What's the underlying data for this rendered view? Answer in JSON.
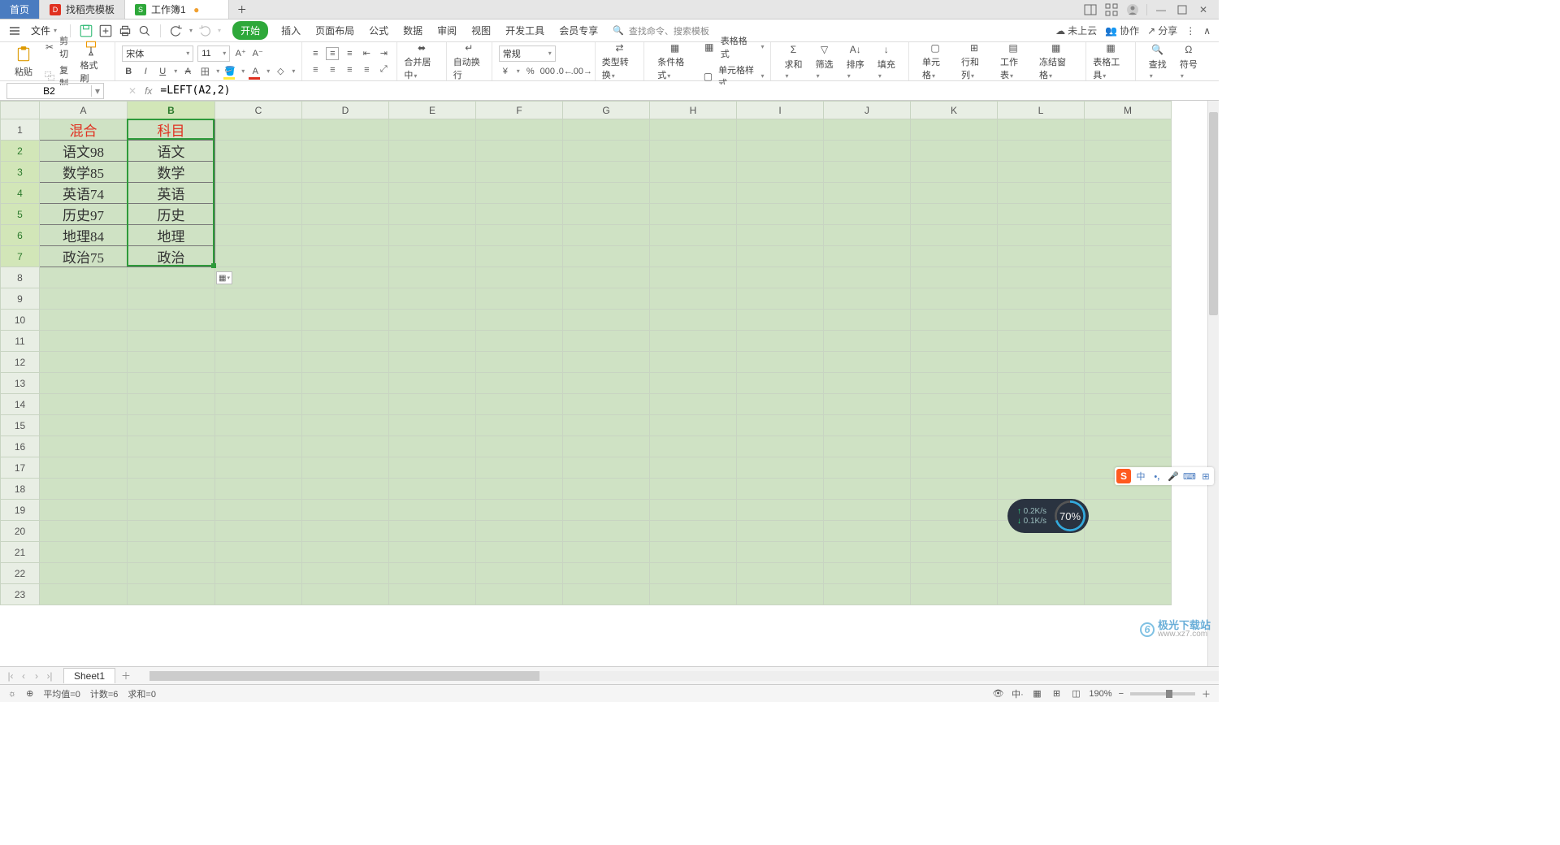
{
  "tabs": {
    "home": "首页",
    "template": "找稻壳模板",
    "workbook": "工作簿1"
  },
  "menu": {
    "file": "文件",
    "items": [
      "开始",
      "插入",
      "页面布局",
      "公式",
      "数据",
      "审阅",
      "视图",
      "开发工具",
      "会员专享"
    ],
    "search_placeholder": "查找命令、搜索模板",
    "cloud": "未上云",
    "collab": "协作",
    "share": "分享"
  },
  "ribbon": {
    "paste": "粘贴",
    "cut": "剪切",
    "copy": "复制",
    "format_painter": "格式刷",
    "font_name": "宋体",
    "font_size": "11",
    "merge_center": "合并居中",
    "wrap_text": "自动换行",
    "number_format": "常规",
    "type_convert": "类型转换",
    "cond_fmt": "条件格式",
    "table_style": "表格格式",
    "cell_style": "单元格样式",
    "sum": "求和",
    "filter": "筛选",
    "sort": "排序",
    "fill": "填充",
    "cell": "单元格",
    "row_col": "行和列",
    "worksheet": "工作表",
    "freeze": "冻结窗格",
    "table_tools": "表格工具",
    "find": "查找",
    "symbol": "符号"
  },
  "name_box": "B2",
  "formula": "=LEFT(A2,2)",
  "columns": [
    "A",
    "B",
    "C",
    "D",
    "E",
    "F",
    "G",
    "H",
    "I",
    "J",
    "K",
    "L",
    "M"
  ],
  "rows_visible": 23,
  "headers": {
    "A": "混合",
    "B": "科目"
  },
  "table": [
    {
      "A": "语文98",
      "B": "语文"
    },
    {
      "A": "数学85",
      "B": "数学"
    },
    {
      "A": "英语74",
      "B": "英语"
    },
    {
      "A": "历史97",
      "B": "历史"
    },
    {
      "A": "地理84",
      "B": "地理"
    },
    {
      "A": "政治75",
      "B": "政治"
    }
  ],
  "sheet": {
    "name": "Sheet1"
  },
  "status": {
    "avg": "平均值=0",
    "count": "计数=6",
    "sum": "求和=0"
  },
  "zoom": "190%",
  "ime": {
    "lang": "中"
  },
  "perf": {
    "up": "0.2K/s",
    "down": "0.1K/s",
    "pct": "70%"
  },
  "watermark": {
    "brand": "极光下载站",
    "url": "www.xz7.com"
  }
}
